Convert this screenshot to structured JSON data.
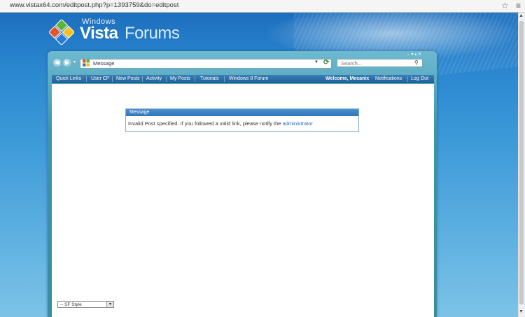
{
  "browser": {
    "url": "www.vistax64.com/editpost.php?p=1393759&do=editpost"
  },
  "logo": {
    "windows": "Windows",
    "vista": "Vista",
    "forums": "Forums"
  },
  "toolbar": {
    "address_text": "Message",
    "search_placeholder": "Search..."
  },
  "nav": {
    "items": [
      "Quick Links",
      "User CP",
      "New Posts",
      "Activity",
      "My Posts",
      "Tutorials",
      "Windows 8 Forum"
    ],
    "welcome": "Welcome, Mecanix",
    "notifications": "Notifications",
    "logout": "Log Out"
  },
  "message": {
    "header": "Message",
    "text": "Invalid Post specified. If you followed a valid link, please notify the",
    "link": "administrator"
  },
  "style_selector": {
    "selected": "-- SF Style"
  },
  "colors": {
    "page_bg": "#1f6db4",
    "navbar": "#1e5f97",
    "message_header": "#2f75b8",
    "link": "#2a66b5"
  }
}
